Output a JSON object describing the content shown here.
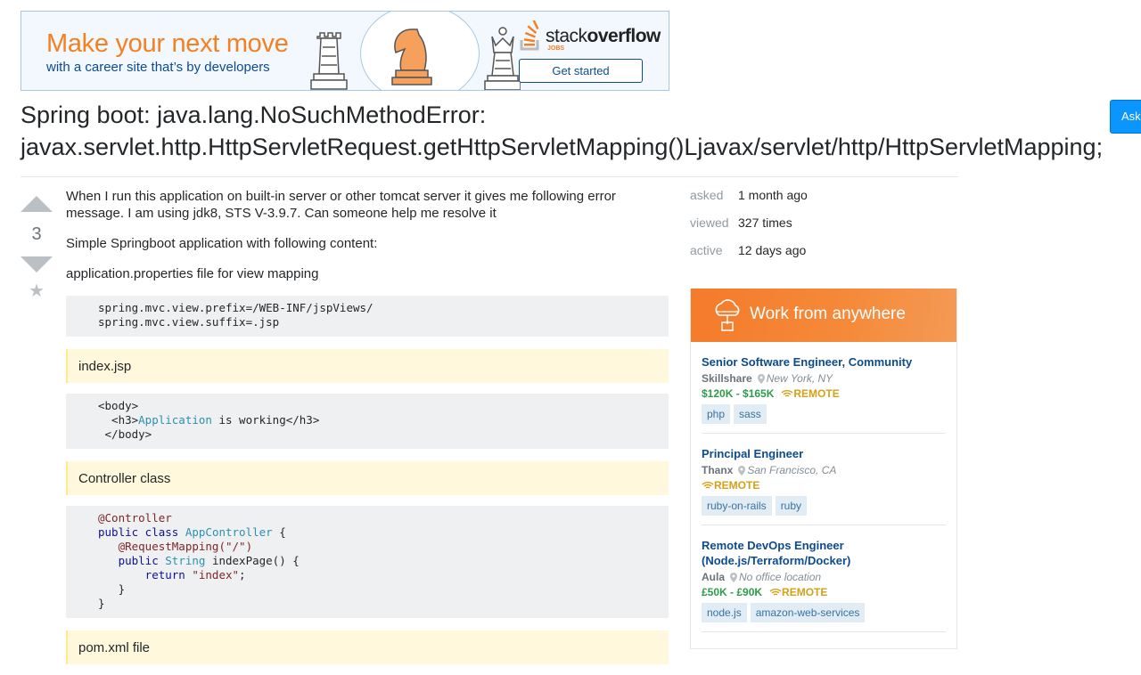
{
  "banner": {
    "headline": "Make your next move",
    "subline": "with a career site that’s by developers",
    "logo_stack": "stack",
    "logo_overflow": "overflow",
    "logo_jobs": "JOBS",
    "cta": "Get started"
  },
  "ask_button": "Ask",
  "question": {
    "title": "Spring boot: java.lang.NoSuchMethodError: javax.servlet.http.HttpServletRequest.getHttpServletMapping()Ljavax/servlet/http/HttpServletMapping;",
    "votes": "3",
    "p1": "When I run this application on built-in server or other tomcat server it gives me following error message. I am using jdk8, STS V-3.9.7. Can someone help me resolve it",
    "p2": "Simple Springboot application with following content:",
    "p3": "application.properties file for view mapping",
    "code1_line1": "spring.mvc.view.prefix=/WEB-INF/jspViews/",
    "code1_line2": "spring.mvc.view.suffix=.jsp",
    "quote1": "index.jsp",
    "code2_l1": "<body>",
    "code2_l2a": "  <h3>",
    "code2_l2b": "Application",
    "code2_l2c": " is working</h3>",
    "code2_l3": " </body>",
    "quote2": "Controller class",
    "code3": {
      "l1": "@Controller",
      "l2_kw": "public class ",
      "l2_type": "AppController",
      "l2_rest": " {",
      "l3": "   @RequestMapping(\"/\")",
      "l4_kw": "   public ",
      "l4_type": "String",
      "l4_rest": " indexPage() {",
      "l5_kw": "       return ",
      "l5_str": "\"index\"",
      "l5_rest": ";",
      "l6": "   }",
      "l7": "}"
    },
    "quote3": "pom.xml file"
  },
  "stats": {
    "asked_label": "asked",
    "asked_value": "1 month ago",
    "viewed_label": "viewed",
    "viewed_value": "327 times",
    "active_label": "active",
    "active_value": "12 days ago"
  },
  "jobs": {
    "header": "Work from anywhere",
    "items": [
      {
        "title": "Senior Software Engineer, Community",
        "company": "Skillshare",
        "location": "New York, NY",
        "salary": "$120K - $165K",
        "remote": "REMOTE",
        "tags": [
          "php",
          "sass"
        ]
      },
      {
        "title": "Principal Engineer",
        "company": "Thanx",
        "location": "San Francisco, CA",
        "salary": "",
        "remote": "REMOTE",
        "tags": [
          "ruby-on-rails",
          "ruby"
        ]
      },
      {
        "title": "Remote DevOps Engineer (Node.js/Terraform/Docker)",
        "company": "Aula",
        "location": "No office location",
        "salary": "£50K - £90K",
        "remote": "REMOTE",
        "tags": [
          "node.js",
          "amazon-web-services"
        ]
      }
    ]
  },
  "colors": {
    "accent": "#f48024",
    "link": "#0c4b8e",
    "tag_bg": "#e1ecf4"
  }
}
